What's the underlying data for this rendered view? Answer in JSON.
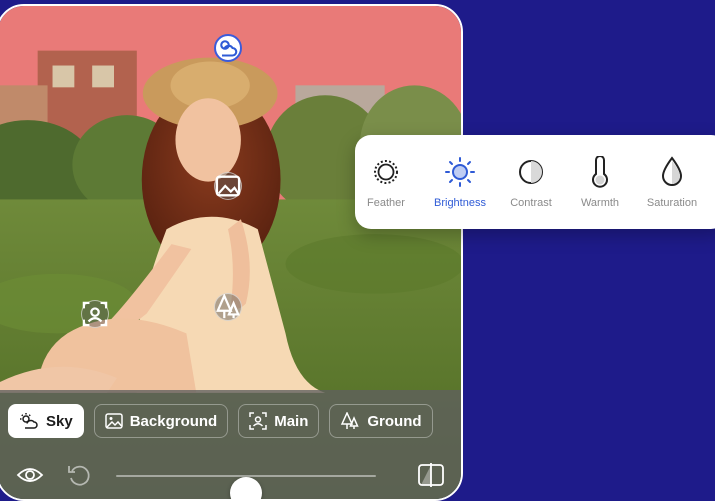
{
  "regions": [
    {
      "label": "Sky",
      "icon": "sky-icon",
      "selected": true
    },
    {
      "label": "Background",
      "icon": "image-icon",
      "selected": false
    },
    {
      "label": "Main",
      "icon": "person-focus-icon",
      "selected": false
    },
    {
      "label": "Ground",
      "icon": "trees-icon",
      "selected": false
    }
  ],
  "adjustments": [
    {
      "label": "Feather",
      "icon": "feather-icon",
      "active": false
    },
    {
      "label": "Brightness",
      "icon": "brightness-icon",
      "active": true
    },
    {
      "label": "Contrast",
      "icon": "contrast-icon",
      "active": false
    },
    {
      "label": "Warmth",
      "icon": "thermometer-icon",
      "active": false
    },
    {
      "label": "Saturation",
      "icon": "droplet-icon",
      "active": false
    }
  ],
  "slider": {
    "value": 0.5
  },
  "colors": {
    "background": "#1e1b8a",
    "accent": "#2f5bd6",
    "sky_mask": "#e97a78"
  }
}
